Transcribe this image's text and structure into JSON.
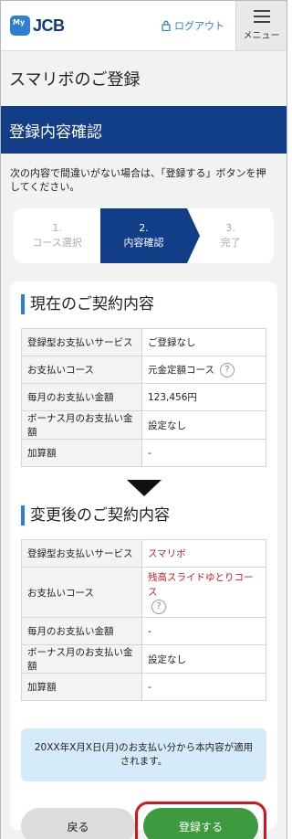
{
  "header": {
    "logo_badge": "My",
    "logo_text": "JCB",
    "logout_label": "ログアウト",
    "menu_label": "メニュー"
  },
  "page_title": "スマリボのご登録",
  "section_band": "登録内容確認",
  "intro": "次の内容で間違いがない場合は、「登録する」ボタンを押してください。",
  "steps": [
    {
      "num": "1.",
      "label": "コース選択",
      "active": false
    },
    {
      "num": "2.",
      "label": "内容確認",
      "active": true
    },
    {
      "num": "3.",
      "label": "完了",
      "active": false
    }
  ],
  "current": {
    "title": "現在のご契約内容",
    "rows": [
      {
        "k": "登録型お支払いサービス",
        "v": "ご登録なし"
      },
      {
        "k": "お支払いコース",
        "v": "元金定額コース"
      },
      {
        "k": "毎月のお支払い金額",
        "v": "123,456円"
      },
      {
        "k": "ボーナス月のお支払い金額",
        "v": "設定なし"
      },
      {
        "k": "加算額",
        "v": "-"
      }
    ]
  },
  "after": {
    "title": "変更後のご契約内容",
    "rows": [
      {
        "k": "登録型お支払いサービス",
        "v": "スマリボ"
      },
      {
        "k": "お支払いコース",
        "v": "残高スライドゆとりコース"
      },
      {
        "k": "毎月のお支払い金額",
        "v": "-"
      },
      {
        "k": "ボーナス月のお支払い金額",
        "v": "設定なし"
      },
      {
        "k": "加算額",
        "v": "-"
      }
    ]
  },
  "notice": "20XX年X月X日(月)のお支払い分から本内容が適用されます。",
  "buttons": {
    "back": "戻る",
    "register": "登録する"
  },
  "colors": {
    "navy": "#123d87",
    "accent_blue": "#2c7fd4",
    "red_text": "#c0202a",
    "register_green": "#3e9a3e",
    "highlight_red": "#d2161e"
  }
}
